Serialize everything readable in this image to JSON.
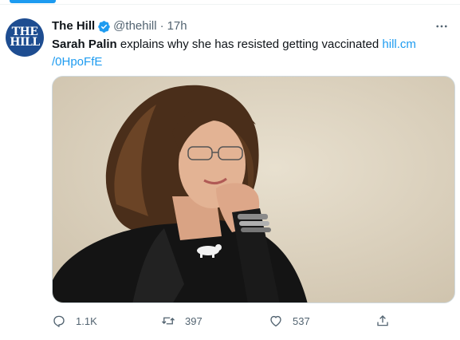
{
  "tweet": {
    "author_name": "The Hill",
    "handle": "@thehill",
    "separator": "·",
    "time": "17h",
    "avatar_text_line1": "THE",
    "avatar_text_line2": "HILL",
    "text_bold": "Sarah Palin",
    "text_rest": " explains why she has resisted getting vaccinated ",
    "link_part1": "hill.cm",
    "link_part2": "/0HpoFfE",
    "image_name": "sarah-palin-photo"
  },
  "actions": {
    "reply_count": "1.1K",
    "retweet_count": "397",
    "like_count": "537"
  },
  "colors": {
    "accent": "#1d9bf0",
    "text": "#0f1419",
    "secondary": "#536471",
    "avatar_bg": "#1e4d91"
  },
  "icons": [
    "verified-badge-icon",
    "more-icon",
    "reply-icon",
    "retweet-icon",
    "like-icon",
    "share-icon"
  ]
}
